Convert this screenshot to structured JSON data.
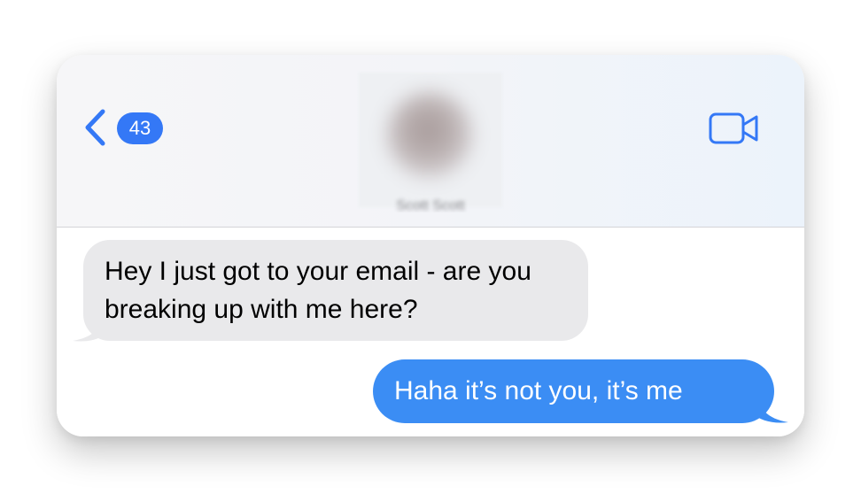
{
  "header": {
    "unread_count": "43",
    "contact_name": "Scott Scott"
  },
  "icons": {
    "back": "chevron-left-icon",
    "video": "video-camera-icon"
  },
  "colors": {
    "accent": "#3478f6",
    "incoming_bubble": "#e9e9eb",
    "outgoing_bubble": "#3b8df4"
  },
  "messages": [
    {
      "direction": "incoming",
      "text": "Hey I just got to your email - are you breaking up with me here?"
    },
    {
      "direction": "outgoing",
      "text": "Haha it’s not you, it’s me"
    }
  ]
}
